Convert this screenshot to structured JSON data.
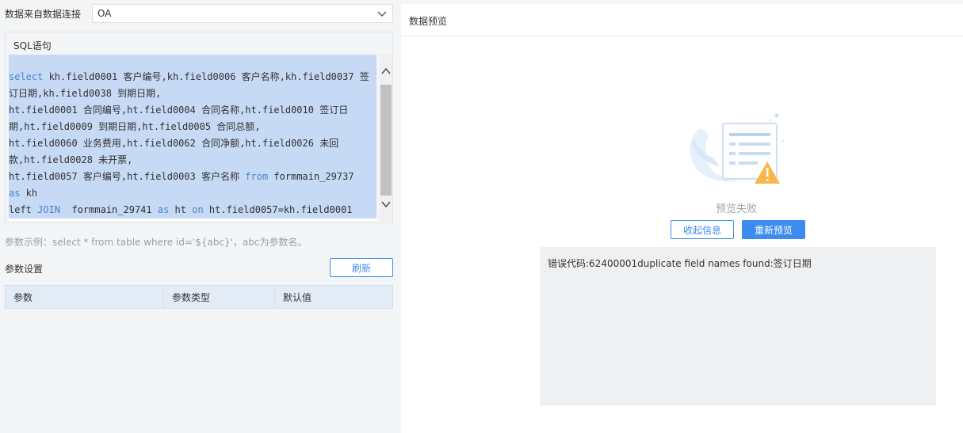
{
  "connection": {
    "label": "数据来自数据连接",
    "selected": "OA"
  },
  "sql": {
    "title": "SQL语句",
    "lines": [
      [
        {
          "t": "select",
          "kw": true
        },
        {
          "t": " kh.field0001 客户编号,kh.field0006 客户名称,kh.field0037 签"
        }
      ],
      [
        {
          "t": "订日期,kh.field0038 到期日期,"
        }
      ],
      [
        {
          "t": "ht.field0001 合同编号,ht.field0004 合同名称,ht.field0010 签订日"
        }
      ],
      [
        {
          "t": "期,ht.field0009 到期日期,ht.field0005 合同总额,"
        }
      ],
      [
        {
          "t": "ht.field0060 业务费用,ht.field0062 合同净额,ht.field0026 未回"
        }
      ],
      [
        {
          "t": "款,ht.field0028 未开票,"
        }
      ],
      [
        {
          "t": "ht.field0057 客户编号,ht.field0003 客户名称 "
        },
        {
          "t": "from",
          "kw": true
        },
        {
          "t": " formmain_29737"
        }
      ],
      [
        {
          "t": "as",
          "kw": true
        },
        {
          "t": " kh"
        }
      ],
      [
        {
          "t": "left ",
          "kw": false
        },
        {
          "t": "JOIN",
          "kw": true
        },
        {
          "t": "  formmain_29741 "
        },
        {
          "t": "as",
          "kw": true
        },
        {
          "t": " ht "
        },
        {
          "t": "on",
          "kw": true
        },
        {
          "t": " ht.field0057=kh.field0001"
        }
      ]
    ]
  },
  "hint": "参数示例：select * from table where id='${abc}'，abc为参数名。",
  "params": {
    "title": "参数设置",
    "refresh_label": "刷新",
    "columns": [
      "参数",
      "参数类型",
      "默认值"
    ]
  },
  "preview": {
    "title": "数据预览",
    "fail_text": "预览失败",
    "collapse_label": "收起信息",
    "repreview_label": "重新预览",
    "error_message": "错误代码:62400001duplicate field names found:签订日期"
  },
  "colors": {
    "accent": "#3d8bef",
    "selection": "#c6d9f5",
    "keyword": "#4a86c9"
  }
}
